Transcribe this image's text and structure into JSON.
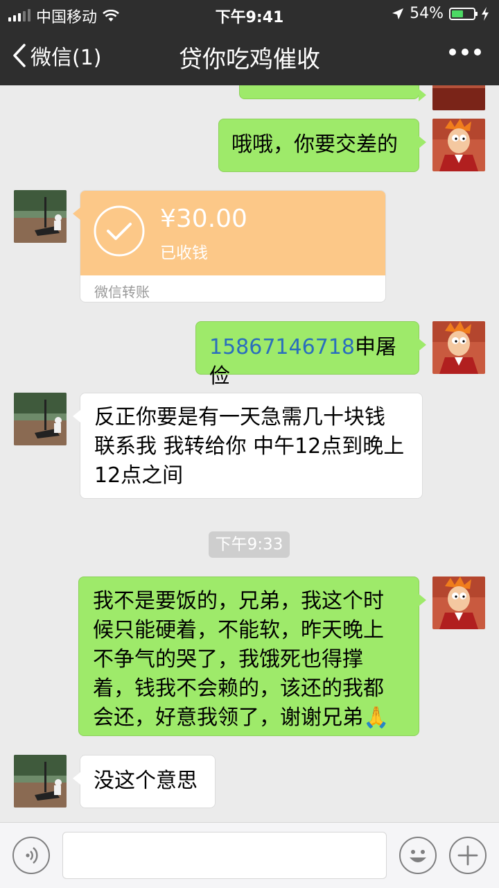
{
  "status_bar": {
    "carrier": "中国移动",
    "time": "下午9:41",
    "battery_text": "54%",
    "battery_level": 0.54
  },
  "nav": {
    "back_label": "微信(1)",
    "title": "贷你吃鸡催收"
  },
  "messages": {
    "m1": {
      "text": "哦哦，你要交差的"
    },
    "transfer": {
      "amount": "¥30.00",
      "status": "已收钱",
      "label": "微信转账"
    },
    "m3": {
      "phone": "15867146718",
      "name": "申屠俭"
    },
    "m4": {
      "line1": "反正你要是有一天急需几十块钱",
      "line2": "联系我 我转给你 中午12点到晚上",
      "line3": "12点之间"
    },
    "timestamp": "下午9:33",
    "m5": {
      "line1": "我不是要饭的，兄弟，我这个时",
      "line2": "候只能硬着，不能软，昨天晚上",
      "line3": "不争气的哭了，我饿死也得撑",
      "line4": "着，钱我不会赖的，该还的我都",
      "line5": "会还，好意我领了，谢谢兄弟🙏"
    },
    "m6": {
      "text": "没这个意思"
    }
  },
  "colors": {
    "topbar": "#2e2e2e",
    "chat_bg": "#ebebeb",
    "bubble_green": "#9eea6a",
    "transfer_orange": "#fcc888",
    "battery_green": "#4cd964"
  }
}
